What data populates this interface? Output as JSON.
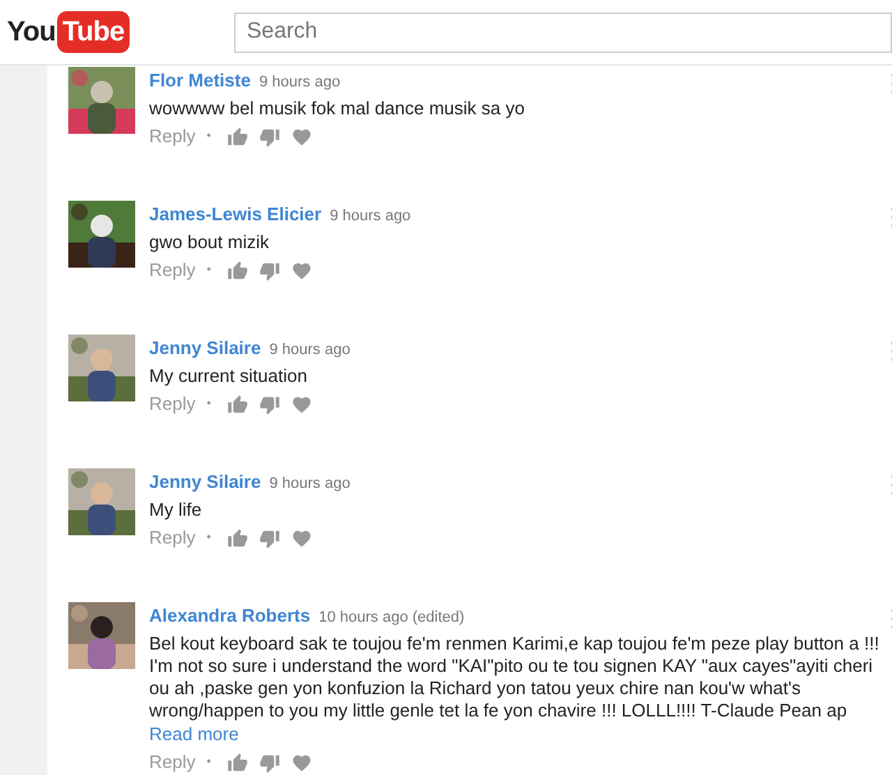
{
  "header": {
    "logo": {
      "first": "You",
      "second": "Tube"
    },
    "search": {
      "placeholder": "Search"
    }
  },
  "comments": [
    {
      "author": "Flor Metiste",
      "time": "9 hours ago",
      "text": "wowwww bel musik fok mal dance musik sa yo",
      "reply": "Reply",
      "sep": "•"
    },
    {
      "author": "James-Lewis Elicier",
      "time": "9 hours ago",
      "text": "gwo bout mizik",
      "reply": "Reply",
      "sep": "•"
    },
    {
      "author": "Jenny Silaire",
      "time": "9 hours ago",
      "text": "My current situation",
      "reply": "Reply",
      "sep": "•"
    },
    {
      "author": "Jenny Silaire",
      "time": "9 hours ago",
      "text": "My life",
      "reply": "Reply",
      "sep": "•"
    },
    {
      "author": "Alexandra Roberts",
      "time": "10 hours ago (edited)",
      "text": "Bel kout keyboard sak te toujou fe'm renmen Karimi,e kap toujou fe'm peze play button a !!! I'm not so sure i understand the word \"KAI\"pito ou te tou signen KAY \"aux cayes\"ayiti cheri ou ah ,paske gen yon konfuzion la Richard yon tatou yeux chire nan kou'w what's wrong/happen to you my little genle tet la fe yon chavire !!! LOLLL!!!! T-Claude Pean ap",
      "read_more": "Read more",
      "reply": "Reply",
      "sep": "•"
    }
  ]
}
